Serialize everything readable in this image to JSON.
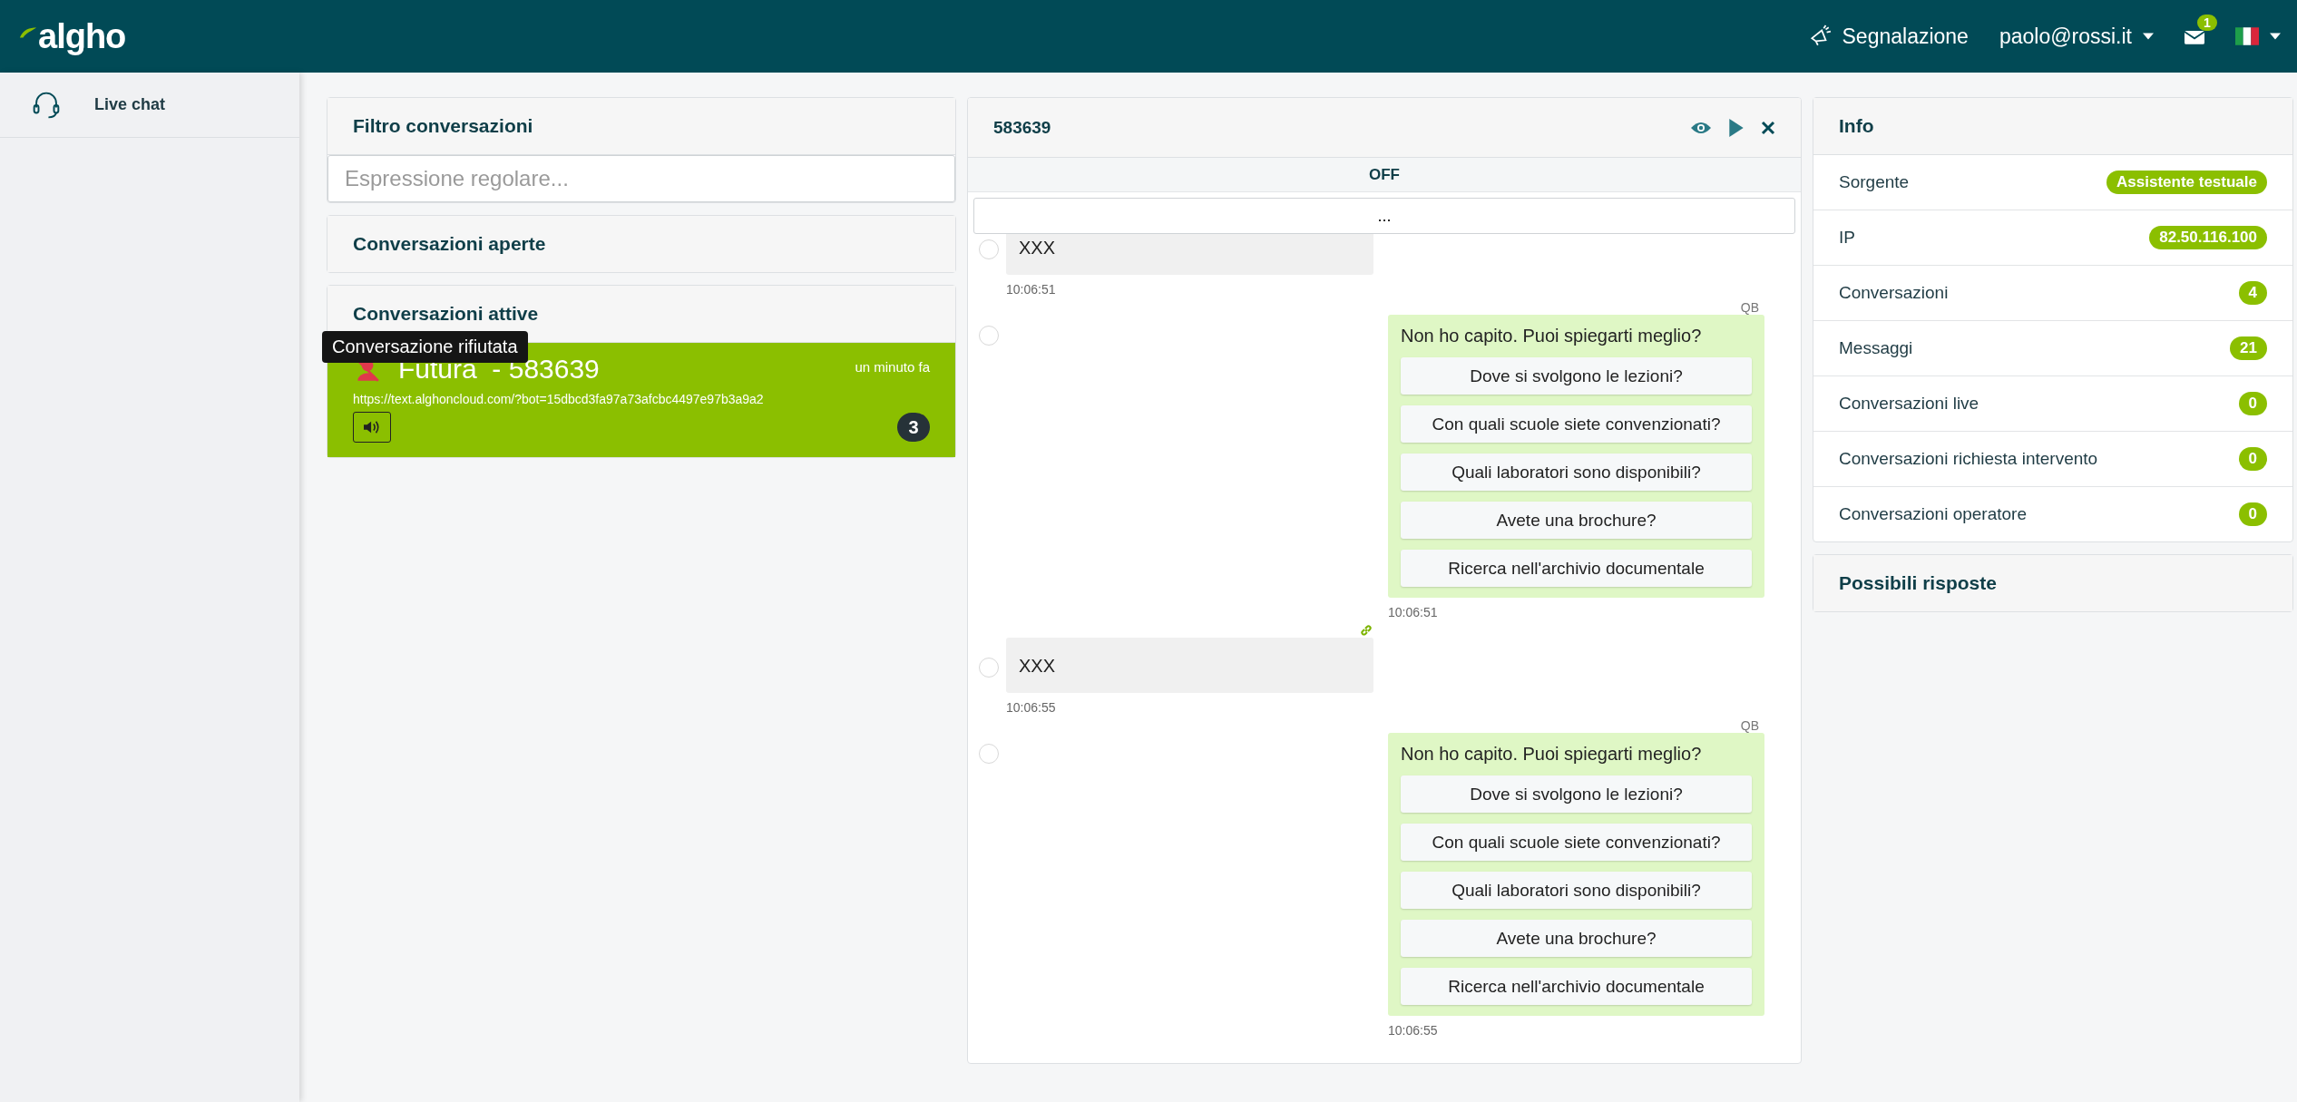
{
  "header": {
    "logo": "algho",
    "report": "Segnalazione",
    "user": "paolo@rossi.it",
    "notifications": "1"
  },
  "sidebar": {
    "items": [
      {
        "label": "Live chat"
      }
    ]
  },
  "filter": {
    "title": "Filtro conversazioni",
    "placeholder": "Espressione regolare..."
  },
  "open_conversations": {
    "title": "Conversazioni aperte"
  },
  "active_conversations": {
    "title": "Conversazioni attive",
    "tooltip": "Conversazione rifiutata",
    "items": [
      {
        "name": "Futura  - 583639",
        "time": "un minuto fa",
        "url": "https://text.alghoncloud.com/?bot=15dbcd3fa97a73afcbc4497e97b3a9a2",
        "count": "3",
        "selected": true
      }
    ]
  },
  "chat": {
    "title": "583639",
    "status": "OFF",
    "load_more": "...",
    "messages": [
      {
        "kind": "user",
        "text": "XXX",
        "time": "10:06:51",
        "linked": false,
        "selected": false
      },
      {
        "kind": "bot",
        "sender": "QB",
        "text": "Non ho capito. Puoi spiegarti meglio?",
        "options": [
          "Dove si svolgono le lezioni?",
          "Con quali scuole siete convenzionati?",
          "Quali laboratori sono disponibili?",
          "Avete una brochure?",
          "Ricerca nell'archivio documentale"
        ],
        "time": "10:06:51",
        "selected": false
      },
      {
        "kind": "user",
        "text": "XXX",
        "time": "10:06:55",
        "linked": true,
        "selected": false
      },
      {
        "kind": "bot",
        "sender": "QB",
        "text": "Non ho capito. Puoi spiegarti meglio?",
        "options": [
          "Dove si svolgono le lezioni?",
          "Con quali scuole siete convenzionati?",
          "Quali laboratori sono disponibili?",
          "Avete una brochure?",
          "Ricerca nell'archivio documentale"
        ],
        "time": "10:06:55",
        "selected": false
      }
    ]
  },
  "info": {
    "title": "Info",
    "rows": [
      {
        "label": "Sorgente",
        "value": "Assistente testuale"
      },
      {
        "label": "IP",
        "value": "82.50.116.100"
      },
      {
        "label": "Conversazioni",
        "value": "4"
      },
      {
        "label": "Messaggi",
        "value": "21"
      },
      {
        "label": "Conversazioni live",
        "value": "0"
      },
      {
        "label": "Conversazioni richiesta intervento",
        "value": "0"
      },
      {
        "label": "Conversazioni operatore",
        "value": "0"
      }
    ]
  },
  "possible_answers": {
    "title": "Possibili risposte"
  }
}
